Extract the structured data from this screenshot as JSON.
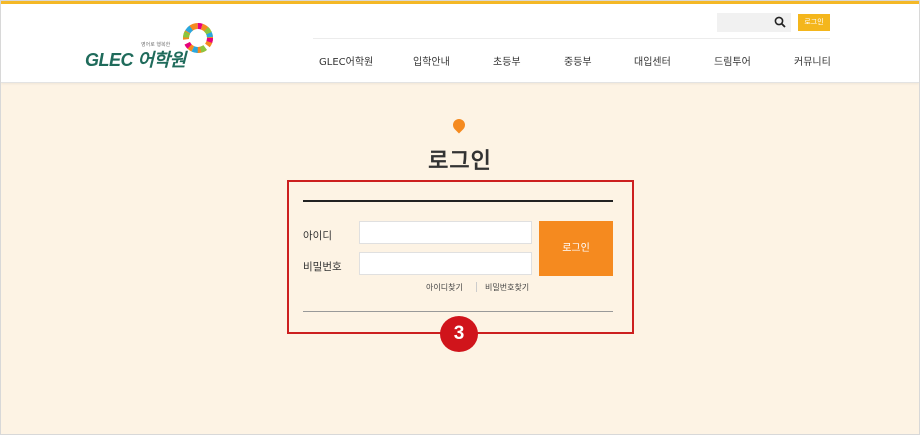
{
  "header": {
    "logo_text": "GLEC 어학원",
    "logo_subtext": "영어로 행복한",
    "login_label": "로그인",
    "nav": [
      "GLEC어학원",
      "입학안내",
      "초등부",
      "중등부",
      "대입센터",
      "드림투어",
      "커뮤니티"
    ]
  },
  "main": {
    "title": "로그인",
    "id_label": "아이디",
    "password_label": "비밀번호",
    "login_button": "로그인",
    "find_id": "아이디찾기",
    "find_password": "비밀번호찾기"
  },
  "annotation": {
    "number": "3"
  },
  "colors": {
    "top_bar": "#f4b827",
    "accent": "#f58a1f",
    "highlight": "#cc1f1f",
    "background": "#fdf3e4"
  }
}
